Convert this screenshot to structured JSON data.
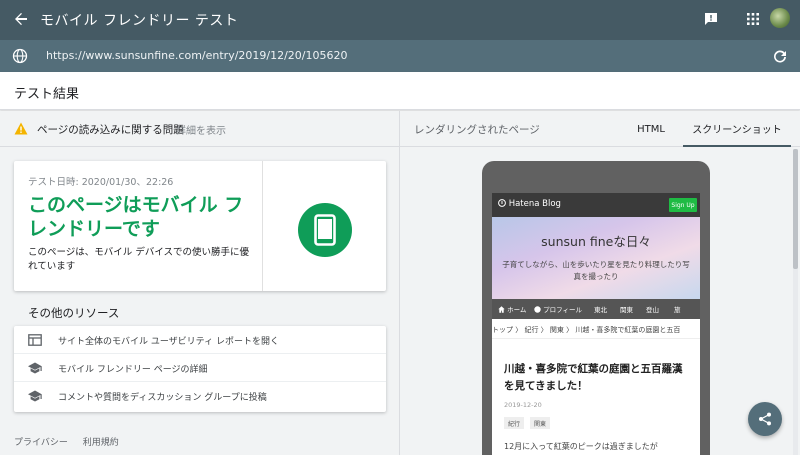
{
  "header": {
    "title": "モバイル フレンドリー テスト",
    "url": "https://www.sunsunfine.com/entry/2019/12/20/105620"
  },
  "results": {
    "title": "テスト結果"
  },
  "issue": {
    "text": "ページの読み込みに関する問題",
    "details_link": "詳細を表示"
  },
  "result_card": {
    "test_date": "テスト日時: 2020/01/30、22:26",
    "verdict": "このページはモバイル フレンドリーです",
    "description": "このページは、モバイル デバイスでの使い勝手に優れています"
  },
  "resources": {
    "title": "その他のリソース",
    "items": [
      {
        "label": "サイト全体のモバイル ユーザビリティ レポートを開く",
        "icon": "report-icon"
      },
      {
        "label": "モバイル フレンドリー ページの詳細",
        "icon": "school-icon"
      },
      {
        "label": "コメントや質問をディスカッション グループに投稿",
        "icon": "school-icon"
      }
    ]
  },
  "footer": {
    "privacy": "プライバシー",
    "terms": "利用規約"
  },
  "right_panel": {
    "rendered_label": "レンダリングされたページ",
    "tabs": [
      {
        "label": "HTML"
      },
      {
        "label": "スクリーンショット",
        "active": true
      }
    ]
  },
  "preview": {
    "logo": "Hatena Blog",
    "signup": "Sign Up",
    "blog_title": "sunsun fineな日々",
    "blog_subtitle": "子育てしながら、山を歩いたり星を見たり料理したり写真を撮ったり",
    "nav": [
      "ホーム",
      "プロフィール",
      "東北",
      "関東",
      "登山",
      "旅"
    ],
    "breadcrumb": "トップ 〉 紀行 〉 関東 〉 川越・喜多院で紅葉の庭園と五百",
    "article_title": "川越・喜多院で紅葉の庭園と五百羅漢を見てきました！",
    "article_date": "2019-12-20",
    "tags": [
      "紀行",
      "関東"
    ],
    "body_start": "12月に入って紅葉のピークは過ぎましたが"
  },
  "colors": {
    "appbar": "#455a64",
    "urlbar": "#546e7a",
    "success_green": "#0f9d58",
    "warning": "#f4b400"
  }
}
